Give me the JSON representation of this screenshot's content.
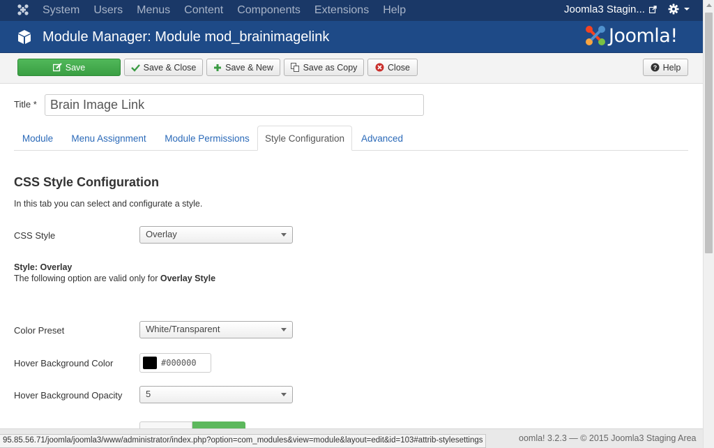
{
  "navbar": {
    "menu": [
      "System",
      "Users",
      "Menus",
      "Content",
      "Components",
      "Extensions",
      "Help"
    ],
    "site_name": "Joomla3 Stagin..."
  },
  "header": {
    "title": "Module Manager: Module mod_brainimagelink",
    "brand": "Joomla!"
  },
  "toolbar": {
    "save_label": "Save",
    "save_close_label": "Save & Close",
    "save_new_label": "Save & New",
    "save_copy_label": "Save as Copy",
    "close_label": "Close",
    "help_label": "Help"
  },
  "form": {
    "title_label": "Title *",
    "title_value": "Brain Image Link"
  },
  "tabs": [
    "Module",
    "Menu Assignment",
    "Module Permissions",
    "Style Configuration",
    "Advanced"
  ],
  "active_tab": "Style Configuration",
  "section": {
    "title": "CSS Style Configuration",
    "description": "In this tab you can select and configurate a style."
  },
  "fields": {
    "css_style_label": "CSS Style",
    "css_style_value": "Overlay",
    "style_heading": "Style: Overlay",
    "style_note_prefix": "The following option are valid only for ",
    "style_note_bold": "Overlay Style",
    "color_preset_label": "Color Preset",
    "color_preset_value": "White/Transparent",
    "hover_bg_color_label": "Hover Background Color",
    "hover_bg_color_value": "#000000",
    "hover_bg_opacity_label": "Hover Background Opacity",
    "hover_bg_opacity_value": "5"
  },
  "footer": {
    "text": "oomla! 3.2.3  —  © 2015 Joomla3 Staging Area"
  },
  "status_url": "95.85.56.71/joomla/joomla3/www/administrator/index.php?option=com_modules&view=module&layout=edit&id=103#attrib-stylesettings",
  "colors": {
    "navbar_bg": "#1a3867",
    "header_bg": "#1e4a87",
    "save_green": "#46a84f",
    "link_blue": "#2a69b8",
    "close_red": "#c9302c"
  }
}
